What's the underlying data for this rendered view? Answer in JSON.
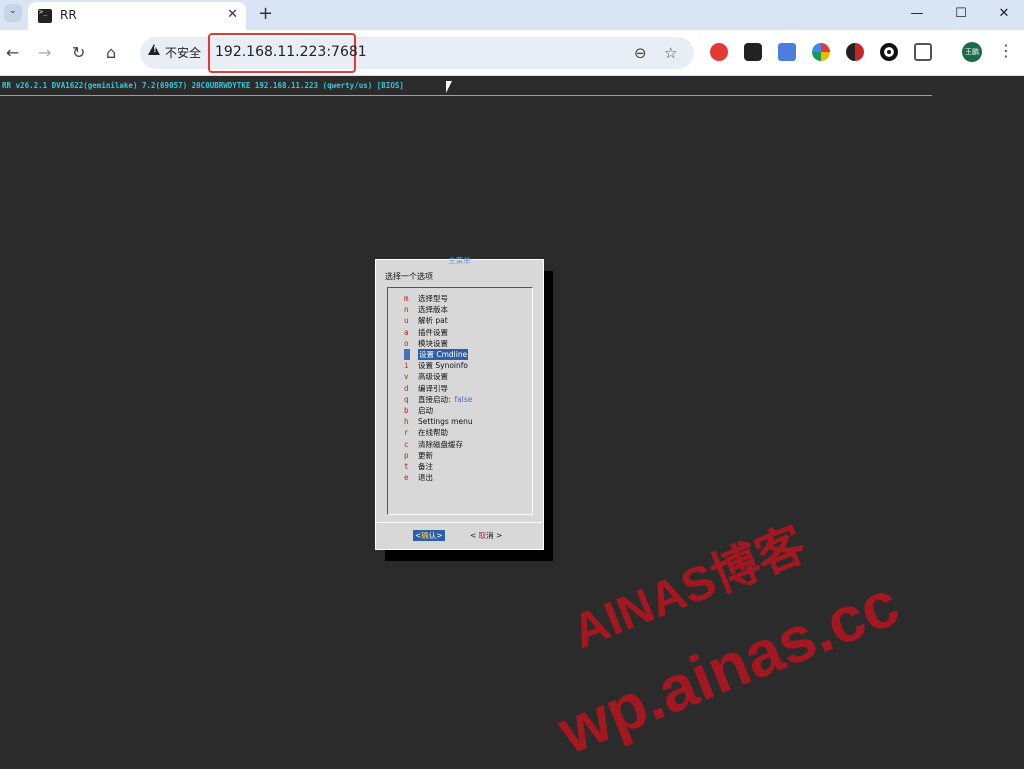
{
  "browser": {
    "tab_title": "RR",
    "tab_list_glyph": "⌄",
    "tab_close": "✕",
    "new_tab": "+",
    "window_controls": {
      "minimize": "—",
      "maximize": "☐",
      "close": "✕"
    },
    "nav": {
      "back": "←",
      "forward": "→",
      "reload": "↻",
      "home": "⌂"
    },
    "security_label": "不安全",
    "url": "192.168.11.223:7681",
    "zoom_glyph": "⊖",
    "bookmark_glyph": "☆",
    "profile_label": "王鹏",
    "menu_glyph": "⋮",
    "extensions": [
      "ext-red",
      "ext-dark",
      "ext-translate",
      "ext-colorful",
      "ext-half-dark",
      "ext-circle",
      "puzzle-icon"
    ]
  },
  "terminal": {
    "header": "RR v26.2.1 DVA1622(geminilake) 7.2(69057) 20C0UBRWDYTKE 192.168.11.223 (qwerty/us) [BIOS]",
    "dialog": {
      "title": "主菜单",
      "prompt": "选择一个选项",
      "items": [
        {
          "key": "m",
          "label": "选择型号"
        },
        {
          "key": "n",
          "label": "选择版本"
        },
        {
          "key": "u",
          "label": "解析 pat"
        },
        {
          "key": "a",
          "label": "插件设置"
        },
        {
          "key": "o",
          "label": "模块设置"
        },
        {
          "key": "x",
          "label": "设置 Cmdline"
        },
        {
          "key": "i",
          "label": "设置 Synoinfo"
        },
        {
          "key": "v",
          "label": "高级设置"
        },
        {
          "key": "d",
          "label": "编译引导"
        },
        {
          "key": "q",
          "label": "直接启动:",
          "value": "false"
        },
        {
          "key": "b",
          "label": "启动"
        },
        {
          "key": "h",
          "label": "Settings menu"
        },
        {
          "key": "r",
          "label": "在线帮助"
        },
        {
          "key": "c",
          "label": "清除磁盘缓存"
        },
        {
          "key": "p",
          "label": "更新"
        },
        {
          "key": "t",
          "label": "备注"
        },
        {
          "key": "e",
          "label": "退出"
        }
      ],
      "selected_index": 5,
      "ok_prefix": "<",
      "ok_hot": "确",
      "ok_rest": "认>",
      "cancel_prefix": "< ",
      "cancel_hot": "取",
      "cancel_rest": "消 >"
    }
  },
  "watermark": {
    "line1": "AINAS博客",
    "line2": "wp.ainas.cc"
  }
}
